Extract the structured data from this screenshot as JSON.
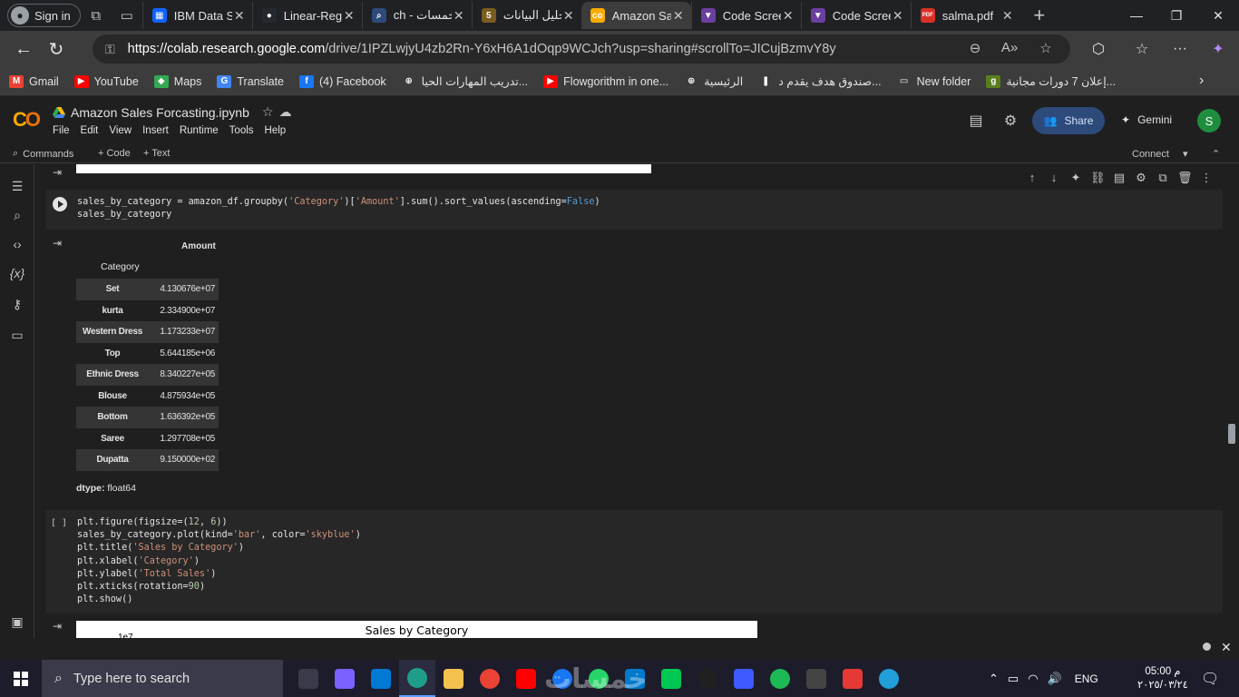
{
  "browser": {
    "signin_label": "Sign in",
    "tabs": [
      {
        "title": "IBM Data S",
        "favicon_color": "#0f62fe",
        "favicon_text": "▦"
      },
      {
        "title": "Linear-Regr",
        "favicon_color": "#24292f",
        "favicon_text": "●"
      },
      {
        "title": "ch - خمسات",
        "favicon_color": "#2d4a7b",
        "favicon_text": "⌕"
      },
      {
        "title": "تحليل البيانات",
        "favicon_color": "#7a5c1e",
        "favicon_text": "5"
      },
      {
        "title": "Amazon Sa",
        "favicon_color": "#f9ab00",
        "favicon_text": "co"
      },
      {
        "title": "Code Scree",
        "favicon_color": "#6b3fa0",
        "favicon_text": "▼"
      },
      {
        "title": "Code Scree",
        "favicon_color": "#6b3fa0",
        "favicon_text": "▼"
      },
      {
        "title": "salma.pdf",
        "favicon_color": "#d93025",
        "favicon_text": "PDF"
      }
    ],
    "active_tab_index": 4,
    "url_host": "https://colab.research.google.com",
    "url_rest": "/drive/1IPZLwjyU4zb2Rn-Y6xH6A1dOqp9WCJch?usp=sharing#scrollTo=JICujBzmvY8y",
    "bookmarks": [
      {
        "label": "Gmail",
        "color": "#ea4335",
        "glyph": "M"
      },
      {
        "label": "YouTube",
        "color": "#ff0000",
        "glyph": "▶"
      },
      {
        "label": "Maps",
        "color": "#34a853",
        "glyph": "◆"
      },
      {
        "label": "Translate",
        "color": "#4285f4",
        "glyph": "G"
      },
      {
        "label": "(4) Facebook",
        "color": "#1877f2",
        "glyph": "f"
      },
      {
        "label": "تدريب المهارات الحيا...",
        "color": "#3c3c3c",
        "glyph": "⊕"
      },
      {
        "label": "Flowgorithm in one...",
        "color": "#ff0000",
        "glyph": "▶"
      },
      {
        "label": "الرئيسية",
        "color": "#3c3c3c",
        "glyph": "⊕"
      },
      {
        "label": "صندوق هدف يقدم د...",
        "color": "#3c3c3c",
        "glyph": "❚"
      },
      {
        "label": "New folder",
        "color": "#3c3c3c",
        "glyph": "▭"
      },
      {
        "label": "إعلان 7 دورات مجانية...",
        "color": "#5a7d1e",
        "glyph": "g"
      }
    ]
  },
  "colab": {
    "notebook_title": "Amazon Sales Forcasting.ipynb",
    "menu": [
      "File",
      "Edit",
      "View",
      "Insert",
      "Runtime",
      "Tools",
      "Help"
    ],
    "share_label": "Share",
    "gemini_label": "Gemini",
    "user_initial": "S",
    "toolbar": {
      "commands": "Commands",
      "add_code": "+ Code",
      "add_text": "+ Text",
      "connect": "Connect"
    }
  },
  "cells": {
    "cell1": {
      "code_lines": [
        "sales_by_category = amazon_df.groupby('Category')['Amount'].sum().sort_values(ascending=False)",
        "sales_by_category"
      ]
    },
    "output1": {
      "column_header": "Amount",
      "index_header": "Category",
      "rows": [
        {
          "category": "Set",
          "amount": "4.130676e+07"
        },
        {
          "category": "kurta",
          "amount": "2.334900e+07"
        },
        {
          "category": "Western Dress",
          "amount": "1.173233e+07"
        },
        {
          "category": "Top",
          "amount": "5.644185e+06"
        },
        {
          "category": "Ethnic Dress",
          "amount": "8.340227e+05"
        },
        {
          "category": "Blouse",
          "amount": "4.875934e+05"
        },
        {
          "category": "Bottom",
          "amount": "1.636392e+05"
        },
        {
          "category": "Saree",
          "amount": "1.297708e+05"
        },
        {
          "category": "Dupatta",
          "amount": "9.150000e+02"
        }
      ],
      "dtype_label": "dtype:",
      "dtype_value": "float64"
    },
    "cell2": {
      "exec_label": "[ ]",
      "code_lines": [
        "plt.figure(figsize=(12, 6))",
        "sales_by_category.plot(kind='bar', color='skyblue')",
        "plt.title('Sales by Category')",
        "plt.xlabel('Category')",
        "plt.ylabel('Total Sales')",
        "plt.xticks(rotation=90)",
        "plt.show()"
      ]
    },
    "output2": {
      "figure_title": "Sales by Category",
      "axis_exponent": "1e7"
    }
  },
  "taskbar": {
    "search_placeholder": "Type here to search",
    "language": "ENG",
    "time": "05:00 م",
    "date": "٢٠٢٥/٠٣/٢٤",
    "watermark": "خمسات",
    "apps": [
      {
        "name": "task-view",
        "color": "#3a3a4a"
      },
      {
        "name": "copilot",
        "color": "#7b61ff"
      },
      {
        "name": "store",
        "color": "#0078d4"
      },
      {
        "name": "edge",
        "color": "#1e9e8a"
      },
      {
        "name": "explorer",
        "color": "#f2c14e"
      },
      {
        "name": "chrome",
        "color": "#ea4335"
      },
      {
        "name": "youtube",
        "color": "#ff0000"
      },
      {
        "name": "facebook",
        "color": "#1877f2"
      },
      {
        "name": "whatsapp",
        "color": "#25d366"
      },
      {
        "name": "vscode",
        "color": "#007acc"
      },
      {
        "name": "app-green",
        "color": "#00c853"
      },
      {
        "name": "app-circle",
        "color": "#202020"
      },
      {
        "name": "app-signal",
        "color": "#3d5afe"
      },
      {
        "name": "spotify",
        "color": "#1db954"
      },
      {
        "name": "app-film",
        "color": "#444444"
      },
      {
        "name": "app-red",
        "color": "#e53935"
      },
      {
        "name": "telegram",
        "color": "#229ed9"
      }
    ]
  }
}
